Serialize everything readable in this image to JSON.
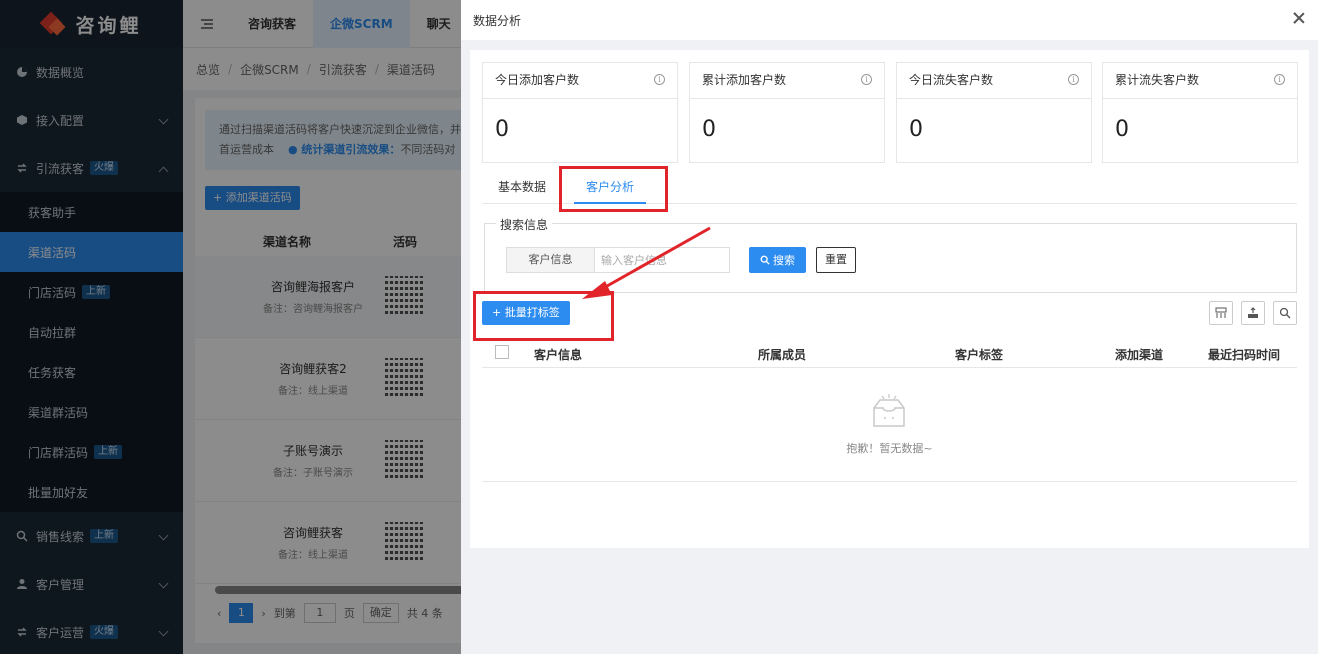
{
  "sidebar": {
    "logo_text": "咨询鲤",
    "items": [
      {
        "label": "数据概览",
        "icon": "pie-chart-icon"
      },
      {
        "label": "接入配置",
        "icon": "cube-icon"
      },
      {
        "label": "引流获客",
        "icon": "refresh-icon",
        "badge": "火爆"
      }
    ],
    "sub_items": [
      {
        "label": "获客助手"
      },
      {
        "label": "渠道活码"
      },
      {
        "label": "门店活码",
        "badge": "上新"
      },
      {
        "label": "自动拉群"
      },
      {
        "label": "任务获客"
      },
      {
        "label": "渠道群活码"
      },
      {
        "label": "门店群活码",
        "badge": "上新"
      },
      {
        "label": "批量加好友"
      }
    ],
    "bottom_items": [
      {
        "label": "销售线索",
        "icon": "search-icon",
        "badge": "上新"
      },
      {
        "label": "客户管理",
        "icon": "user-icon"
      },
      {
        "label": "客户运营",
        "icon": "refresh-icon",
        "badge": "火爆"
      }
    ]
  },
  "topnav": {
    "tabs": [
      "咨询获客",
      "企微SCRM",
      "聊天"
    ]
  },
  "breadcrumb": [
    "总览",
    "企微SCRM",
    "引流获客",
    "渠道活码"
  ],
  "background": {
    "notice_part1": "通过扫描渠道活码将客户快速沉淀到企业微信，并",
    "notice_part2": "首运营成本",
    "notice_highlight": "● 统计渠道引流效果：",
    "notice_part3": "不同活码对",
    "add_button": "+ 添加渠道活码",
    "col_name": "渠道名称",
    "col_code": "活码",
    "rows": [
      {
        "name": "咨询鲤海报客户",
        "note": "备注：咨询鲤海报客户"
      },
      {
        "name": "咨询鲤获客2",
        "note": "备注：线上渠道"
      },
      {
        "name": "子账号演示",
        "note": "备注：子账号演示"
      },
      {
        "name": "咨询鲤获客",
        "note": "备注：线上渠道"
      }
    ],
    "pager": {
      "current": "1",
      "goto": "到第",
      "page_input": "1",
      "page_unit": "页",
      "confirm": "确定",
      "total": "共 4 条"
    }
  },
  "drawer": {
    "title": "数据分析",
    "stats": [
      {
        "title": "今日添加客户数",
        "value": "0"
      },
      {
        "title": "累计添加客户数",
        "value": "0"
      },
      {
        "title": "今日流失客户数",
        "value": "0"
      },
      {
        "title": "累计流失客户数",
        "value": "0"
      }
    ],
    "tabs": [
      "基本数据",
      "客户分析"
    ],
    "search_legend": "搜索信息",
    "field_label": "客户信息",
    "field_placeholder": "输入客户信息",
    "search_button": "搜索",
    "reset_button": "重置",
    "batch_button": "+ 批量打标签",
    "columns": [
      "客户信息",
      "所属成员",
      "客户标签",
      "添加渠道",
      "最近扫码时间"
    ],
    "empty_text": "抱歉！暂无数据~"
  },
  "colors": {
    "accent": "#2d8cf0",
    "highlight": "#e0242a",
    "sidebar_bg": "#1d2a38"
  }
}
